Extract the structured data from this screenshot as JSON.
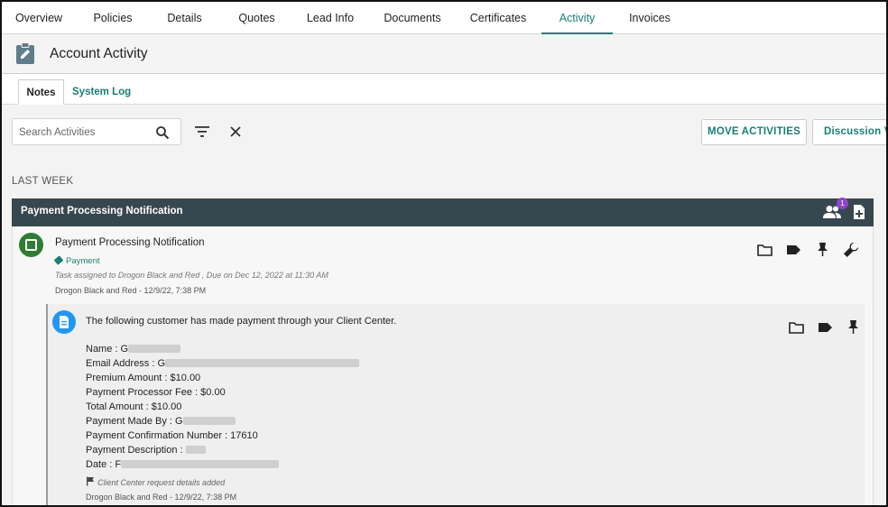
{
  "top_tabs": [
    {
      "label": "Overview"
    },
    {
      "label": "Policies"
    },
    {
      "label": "Details"
    },
    {
      "label": "Quotes"
    },
    {
      "label": "Lead Info"
    },
    {
      "label": "Documents"
    },
    {
      "label": "Certificates"
    },
    {
      "label": "Activity",
      "active": true
    },
    {
      "label": "Invoices"
    }
  ],
  "header": {
    "title": "Account Activity",
    "icon": "clipboard-edit-icon"
  },
  "sub_tabs": {
    "notes": "Notes",
    "system_log": "System Log"
  },
  "toolbar": {
    "search_placeholder": "Search Activities",
    "move_button": "MOVE ACTIVITIES",
    "discussion_button": "Discussion View"
  },
  "section_label": "LAST WEEK",
  "card": {
    "header_title": "Payment Processing Notification",
    "participants_badge": "1",
    "task": {
      "title": "Payment Processing Notification",
      "tag": "Payment",
      "assigned": "Task assigned to Drogon Black and Red , Due on Dec 12, 2022 at 11:30 AM",
      "meta": "Drogon Black and Red - 12/9/22, 7:38 PM"
    },
    "note": {
      "heading": "The following customer has made payment through your Client Center.",
      "fields": {
        "name": "Name : G",
        "email": "Email Address : G",
        "premium": "Premium Amount : $10.00",
        "fee": "Payment Processor Fee : $0.00",
        "total": "Total Amount : $10.00",
        "made_by": "Payment Made By : G",
        "confirmation": "Payment Confirmation Number : 17610",
        "description": "Payment Description :",
        "date": "Date : F"
      },
      "flag_text": "Client Center request details added",
      "meta": "Drogon Black and Red - 12/9/22, 7:38 PM"
    }
  },
  "colors": {
    "accent": "#1a7f73",
    "card_header": "#37474f",
    "task_icon": "#2e7d32",
    "note_icon": "#2196f3",
    "badge": "#8e44c8"
  }
}
